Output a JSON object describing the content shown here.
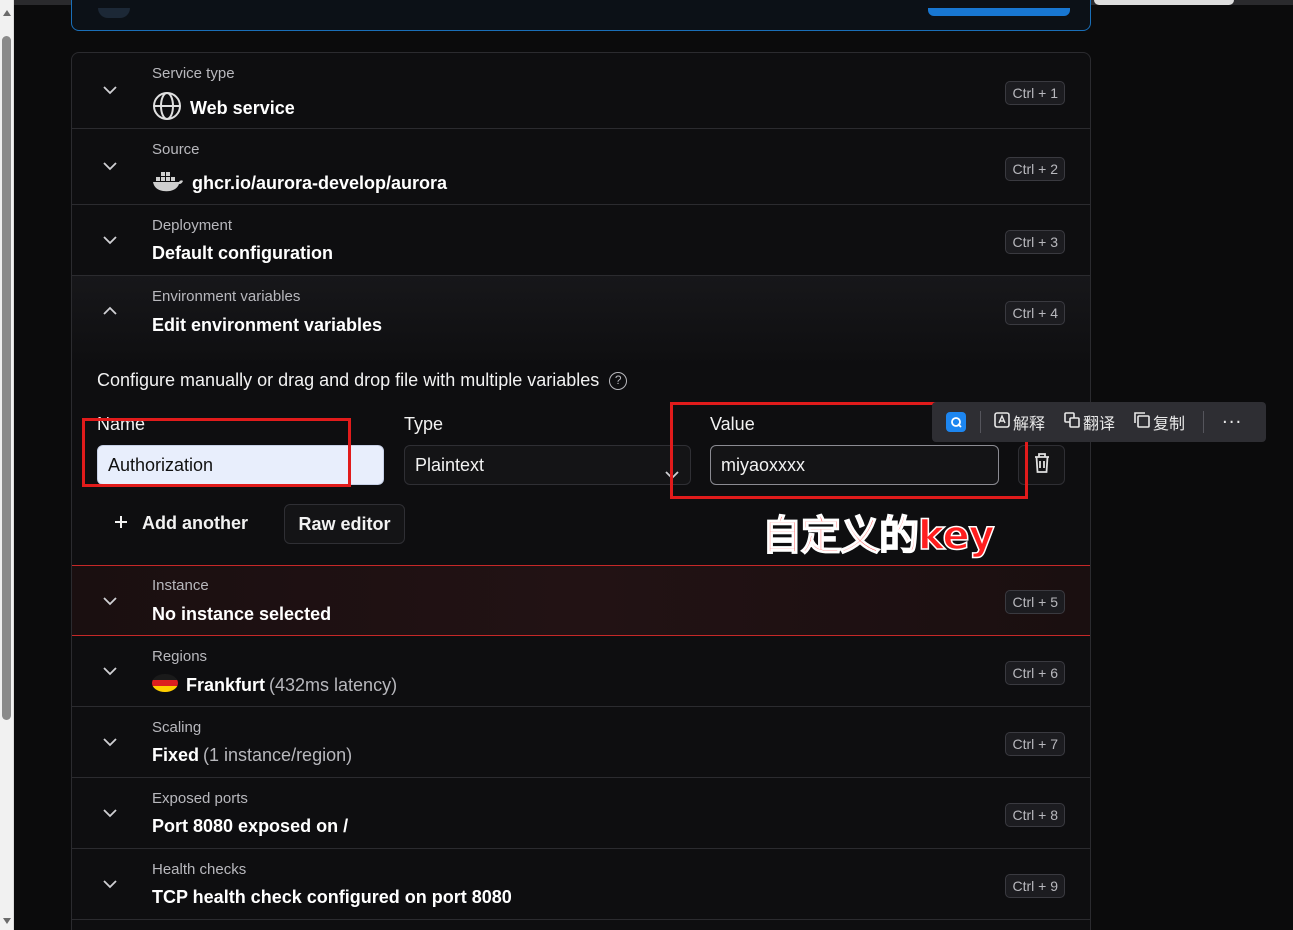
{
  "sections": [
    {
      "label": "Service type",
      "value": "Web service",
      "shortcut": "Ctrl + 1",
      "icon": "globe-icon"
    },
    {
      "label": "Source",
      "value": "ghcr.io/aurora-develop/aurora",
      "shortcut": "Ctrl + 2",
      "icon": "docker-icon"
    },
    {
      "label": "Deployment",
      "value": "Default configuration",
      "shortcut": "Ctrl + 3"
    },
    {
      "label": "Environment variables",
      "value": "Edit environment variables",
      "shortcut": "Ctrl + 4"
    },
    {
      "label": "Instance",
      "value": "No instance selected",
      "shortcut": "Ctrl + 5"
    },
    {
      "label": "Regions",
      "value": "Frankfurt",
      "value_muted": "(432ms latency)",
      "shortcut": "Ctrl + 6",
      "icon": "germany-flag-icon"
    },
    {
      "label": "Scaling",
      "value": "Fixed",
      "value_muted": "(1 instance/region)",
      "shortcut": "Ctrl + 7"
    },
    {
      "label": "Exposed ports",
      "value": "Port 8080 exposed on /",
      "shortcut": "Ctrl + 8"
    },
    {
      "label": "Health checks",
      "value": "TCP health check configured on port 8080",
      "shortcut": "Ctrl + 9"
    }
  ],
  "env": {
    "intro": "Configure manually or drag and drop file with multiple variables",
    "help_glyph": "?",
    "name_label": "Name",
    "type_label": "Type",
    "value_label": "Value",
    "name_value": "Authorization",
    "type_value": "Plaintext",
    "value_value": "miyaoxxxx",
    "add_another": "Add another",
    "raw_editor": "Raw editor"
  },
  "annotation": {
    "text": "自定义的key",
    "color": "#e11b1b"
  },
  "float_toolbar": {
    "explain": "解释",
    "translate": "翻译",
    "copy": "复制",
    "more": "···"
  },
  "colors": {
    "accent_blue": "#1877d2",
    "danger_red": "#c62828",
    "background": "#0b0b0c"
  }
}
